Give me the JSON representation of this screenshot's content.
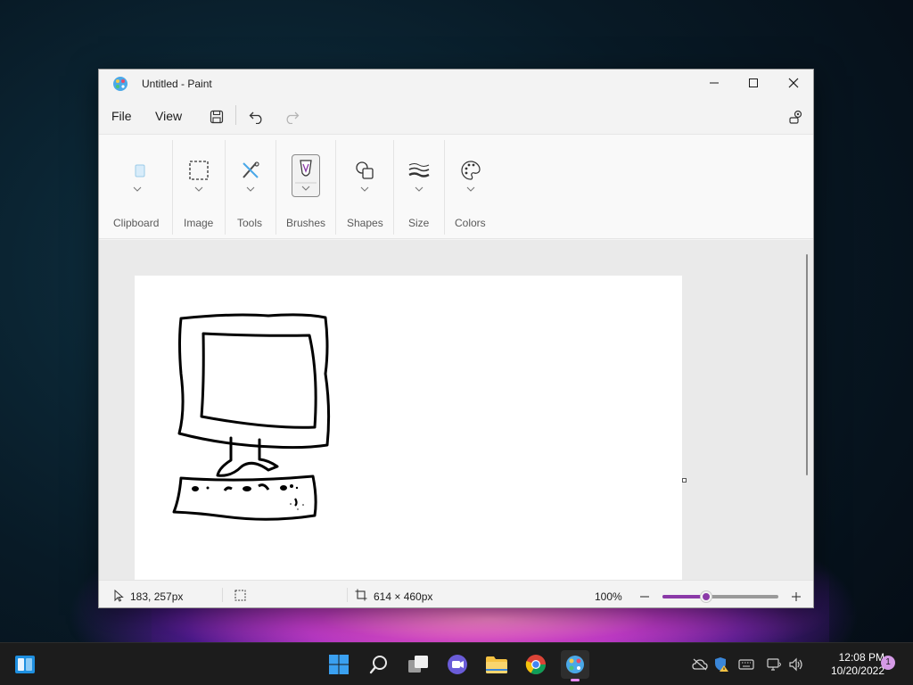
{
  "window": {
    "title": "Untitled - Paint",
    "minimize_icon": "minimize-icon",
    "maximize_icon": "maximize-icon",
    "close_icon": "close-icon"
  },
  "menu": {
    "file": "File",
    "view": "View",
    "save_icon": "save-icon",
    "undo_icon": "undo-icon",
    "redo_icon": "redo-icon",
    "settings_icon": "settings-icon"
  },
  "ribbon": {
    "groups": [
      {
        "label": "Clipboard",
        "icon": "clipboard-icon"
      },
      {
        "label": "Image",
        "icon": "selection-icon"
      },
      {
        "label": "Tools",
        "icon": "tools-icon"
      },
      {
        "label": "Brushes",
        "icon": "brush-icon"
      },
      {
        "label": "Shapes",
        "icon": "shapes-icon"
      },
      {
        "label": "Size",
        "icon": "size-icon"
      },
      {
        "label": "Colors",
        "icon": "palette-icon"
      }
    ]
  },
  "status": {
    "cursor_position": "183, 257px",
    "canvas_size": "614 × 460px",
    "zoom_level": "100%",
    "zoom_fraction": 0.38
  },
  "taskbar": {
    "time": "12:08 PM",
    "date": "10/20/2022",
    "notification_count": "1"
  },
  "colors": {
    "accent": "#8b3aa8",
    "taskbar": "#1c1c1c"
  }
}
